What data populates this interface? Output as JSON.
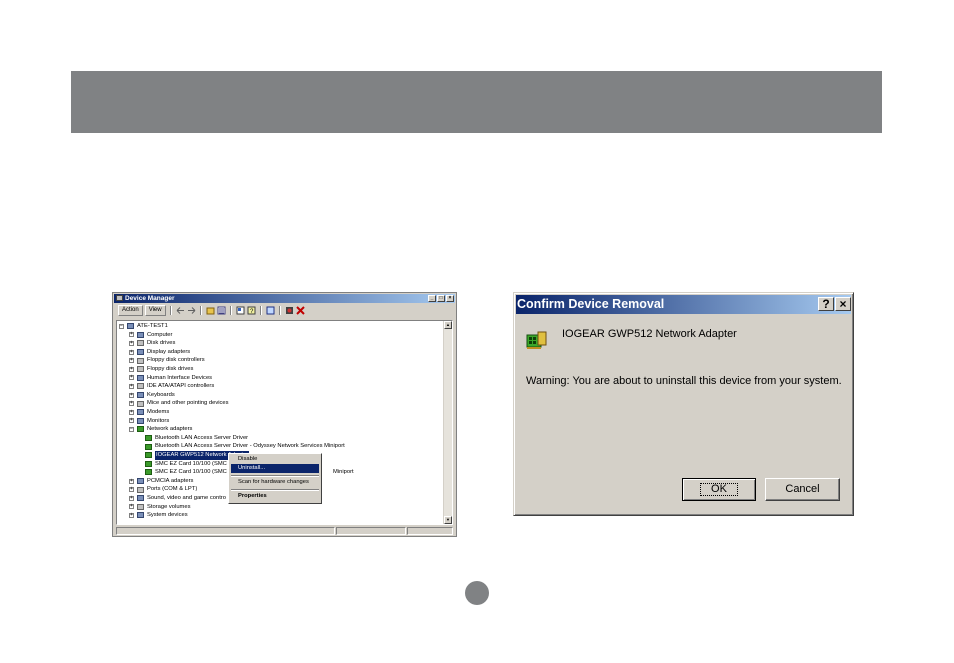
{
  "device_manager": {
    "title": "Device Manager",
    "window_buttons": [
      "_",
      "□",
      "×"
    ],
    "menu": [
      "Action",
      "View"
    ],
    "toolbar_icons": [
      "back-arrow-icon",
      "forward-arrow-icon",
      "folder-icon",
      "list-icon",
      "properties-icon",
      "help-icon",
      "scan-icon",
      "disable-icon",
      "uninstall-icon"
    ],
    "tree": [
      {
        "label": "ATE-TEST1",
        "level": 0,
        "exp": "−",
        "icon": "computer"
      },
      {
        "label": "Computer",
        "level": 1,
        "exp": "+",
        "icon": "gen"
      },
      {
        "label": "Disk drives",
        "level": 1,
        "exp": "+",
        "icon": "drv"
      },
      {
        "label": "Display adapters",
        "level": 1,
        "exp": "+",
        "icon": "gen"
      },
      {
        "label": "Floppy disk controllers",
        "level": 1,
        "exp": "+",
        "icon": "drv"
      },
      {
        "label": "Floppy disk drives",
        "level": 1,
        "exp": "+",
        "icon": "drv"
      },
      {
        "label": "Human Interface Devices",
        "level": 1,
        "exp": "+",
        "icon": "gen"
      },
      {
        "label": "IDE ATA/ATAPI controllers",
        "level": 1,
        "exp": "+",
        "icon": "drv"
      },
      {
        "label": "Keyboards",
        "level": 1,
        "exp": "+",
        "icon": "gen"
      },
      {
        "label": "Mice and other pointing devices",
        "level": 1,
        "exp": "+",
        "icon": "drv"
      },
      {
        "label": "Modems",
        "level": 1,
        "exp": "+",
        "icon": "gen"
      },
      {
        "label": "Monitors",
        "level": 1,
        "exp": "+",
        "icon": "gen"
      },
      {
        "label": "Network adapters",
        "level": 1,
        "exp": "−",
        "icon": "net"
      },
      {
        "label": "Bluetooth LAN Access Server Driver",
        "level": 2,
        "exp": "",
        "icon": "net"
      },
      {
        "label": "Bluetooth LAN Access Server Driver - Odyssey Network Services Miniport",
        "level": 2,
        "exp": "",
        "icon": "net"
      },
      {
        "label": "IOGEAR GWP512 Network Adapter",
        "level": 2,
        "exp": "",
        "icon": "net",
        "selected": true
      },
      {
        "label": "SMC EZ Card 10/100 (SMC",
        "level": 2,
        "exp": "",
        "icon": "net"
      },
      {
        "label": "SMC EZ Card 10/100 (SMC",
        "level": 2,
        "exp": "",
        "icon": "net",
        "suffix": "Miniport"
      },
      {
        "label": "PCMCIA adapters",
        "level": 1,
        "exp": "+",
        "icon": "gen"
      },
      {
        "label": "Ports (COM & LPT)",
        "level": 1,
        "exp": "+",
        "icon": "drv"
      },
      {
        "label": "Sound, video and game contro",
        "level": 1,
        "exp": "+",
        "icon": "gen"
      },
      {
        "label": "Storage volumes",
        "level": 1,
        "exp": "+",
        "icon": "drv"
      },
      {
        "label": "System devices",
        "level": 1,
        "exp": "+",
        "icon": "gen"
      }
    ],
    "context_menu": {
      "disable": "Disable",
      "uninstall": "Uninstall...",
      "scan": "Scan for hardware changes",
      "properties": "Properties"
    }
  },
  "confirm_dialog": {
    "title": "Confirm Device Removal",
    "help_button": "?",
    "close_button": "×",
    "device_name": "IOGEAR GWP512 Network Adapter",
    "warning": "Warning: You are about to uninstall this device from your system.",
    "ok_label": "OK",
    "cancel_label": "Cancel"
  },
  "colors": {
    "banner": "#808284",
    "titlebar_start": "#0a246a",
    "titlebar_end": "#a6caf0",
    "window_face": "#d4d0c8",
    "selection": "#0a246a"
  }
}
